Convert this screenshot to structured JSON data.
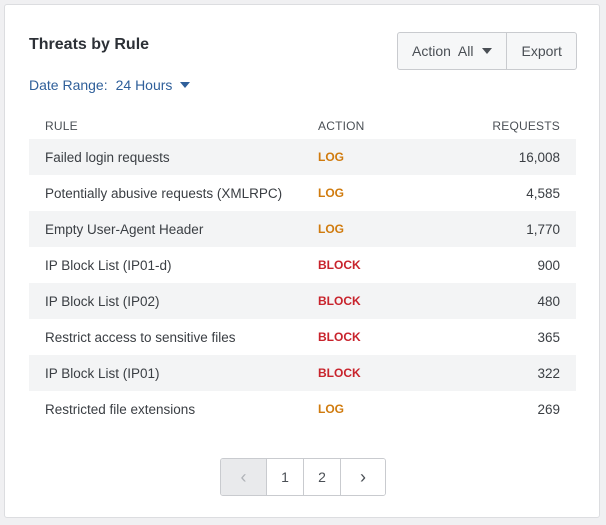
{
  "card": {
    "title": "Threats by Rule",
    "date_range": {
      "label": "Date Range:",
      "value": "24 Hours"
    },
    "action_filter": {
      "label": "Action",
      "value": "All"
    },
    "export_label": "Export"
  },
  "table": {
    "headers": {
      "rule": "RULE",
      "action": "ACTION",
      "requests": "REQUESTS"
    },
    "rows": [
      {
        "rule": "Failed login requests",
        "action": "LOG",
        "requests": "16,008"
      },
      {
        "rule": "Potentially abusive requests (XMLRPC)",
        "action": "LOG",
        "requests": "4,585"
      },
      {
        "rule": "Empty User-Agent Header",
        "action": "LOG",
        "requests": "1,770"
      },
      {
        "rule": "IP Block List (IP01-d)",
        "action": "BLOCK",
        "requests": "900"
      },
      {
        "rule": "IP Block List (IP02)",
        "action": "BLOCK",
        "requests": "480"
      },
      {
        "rule": "Restrict access to sensitive files",
        "action": "BLOCK",
        "requests": "365"
      },
      {
        "rule": "IP Block List (IP01)",
        "action": "BLOCK",
        "requests": "322"
      },
      {
        "rule": "Restricted file extensions",
        "action": "LOG",
        "requests": "269"
      }
    ]
  },
  "pagination": {
    "prev_icon": "chevron-left-icon",
    "pages": [
      "1",
      "2"
    ],
    "current_page": "1",
    "next_icon": "chevron-right-icon"
  },
  "colors": {
    "log": "#d07b0e",
    "block": "#c8232c",
    "link": "#2f5f9a"
  }
}
